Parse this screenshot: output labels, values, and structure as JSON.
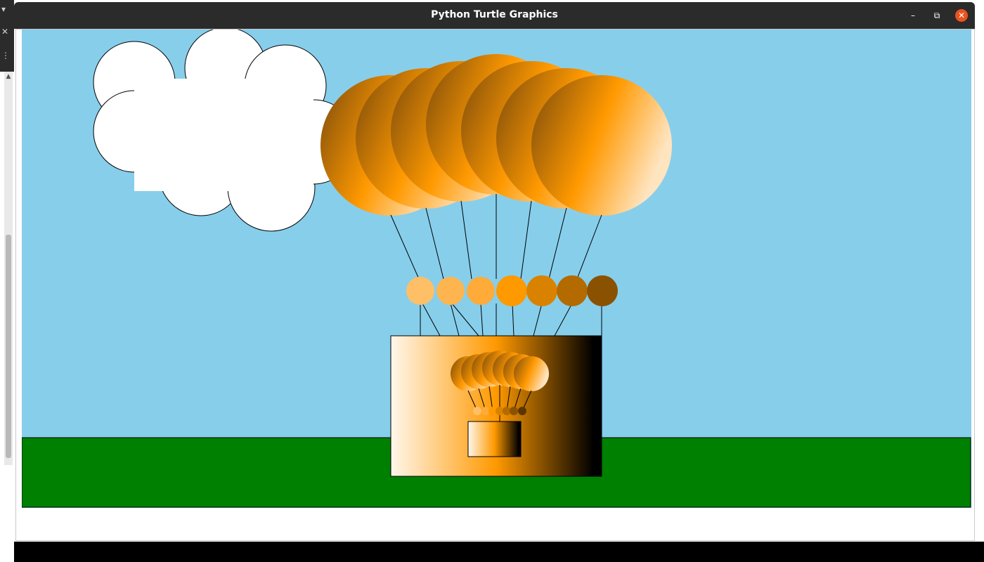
{
  "window": {
    "title": "Python Turtle Graphics",
    "controls": {
      "minimize": "–",
      "maximize": "⧉",
      "close": "✕"
    }
  },
  "left_panel": {
    "menu_icon": "▾",
    "close_icon": "✕",
    "more_icon": "⋮"
  },
  "scrollbar": {
    "up_arrow": "▲"
  },
  "icons": [
    "minimize-icon",
    "maximize-icon",
    "close-icon",
    "chevron-down-icon",
    "more-icon",
    "scroll-up-arrow-icon"
  ],
  "colors": {
    "sky": "#87ceeb",
    "ground": "#008000",
    "balloon_orange": "#ff9900",
    "cloud": "#ffffff",
    "titlebar": "#2b2b2b",
    "close_button": "#e95420"
  }
}
